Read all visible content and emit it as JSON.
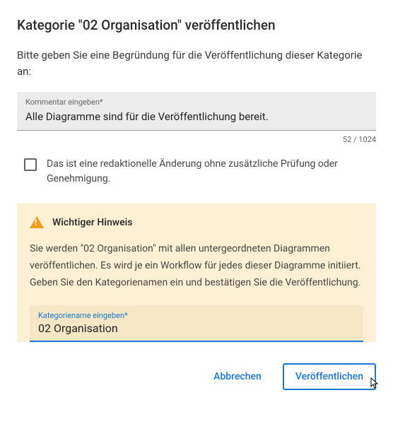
{
  "dialog": {
    "title": "Kategorie \"02 Organisation\" veröffentlichen",
    "description": "Bitte geben Sie eine Begründung für die Veröffentlichung dieser Kategorie an:"
  },
  "comment": {
    "label": "Kommentar eingeben*",
    "value": "Alle Diagramme sind für die Veröffentlichung bereit.",
    "counter": "52 / 1024"
  },
  "editorial": {
    "label": "Das ist eine redaktionelle Änderung ohne zusätzliche Prüfung oder Genehmigung."
  },
  "warning": {
    "title": "Wichtiger Hinweis",
    "text": "Sie werden \"02 Organisation\" mit allen untergeordneten Diagrammen veröffentlichen. Es wird je ein Workflow für jedes dieser Diagramme initiiert. Geben Sie den Kategorienamen ein und bestätigen Sie die Veröffentlichung."
  },
  "category": {
    "label": "Kategoriename eingeben*",
    "value": "02 Organisation"
  },
  "actions": {
    "cancel": "Abbrechen",
    "publish": "Veröffentlichen"
  }
}
